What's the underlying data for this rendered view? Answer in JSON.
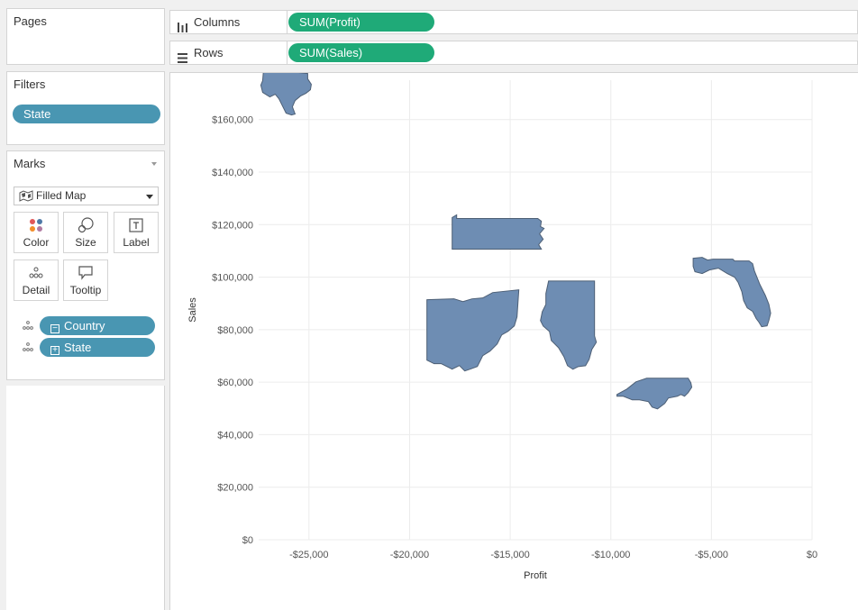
{
  "pages": {
    "title": "Pages"
  },
  "filters": {
    "title": "Filters",
    "pills": [
      {
        "label": "State"
      }
    ]
  },
  "marks": {
    "title": "Marks",
    "mark_type": "Filled Map",
    "buttons": {
      "color": "Color",
      "size": "Size",
      "label": "Label",
      "detail": "Detail",
      "tooltip": "Tooltip"
    },
    "fields": [
      {
        "label": "Country",
        "icon": "collapse-icon"
      },
      {
        "label": "State",
        "icon": "expand-icon"
      }
    ]
  },
  "shelves": {
    "columns": {
      "label": "Columns",
      "pill": "SUM(Profit)"
    },
    "rows": {
      "label": "Rows",
      "pill": "SUM(Sales)"
    }
  },
  "colors": {
    "pill_blue": "#4996b2",
    "pill_green": "#1faa78",
    "mark_fill": "#6e8db3",
    "mark_stroke": "#4d5f75"
  },
  "chart_data": {
    "type": "scatter",
    "mark": "filled-map",
    "xlabel": "Profit",
    "ylabel": "Sales",
    "xlim": [
      -27500,
      0
    ],
    "ylim": [
      0,
      175000
    ],
    "xticks": [
      -25000,
      -20000,
      -15000,
      -10000,
      -5000,
      0
    ],
    "xtick_labels": [
      "-$25,000",
      "-$20,000",
      "-$15,000",
      "-$10,000",
      "-$5,000",
      "$0"
    ],
    "yticks": [
      0,
      20000,
      40000,
      60000,
      80000,
      100000,
      120000,
      140000,
      160000
    ],
    "ytick_labels": [
      "$0",
      "$20,000",
      "$40,000",
      "$60,000",
      "$80,000",
      "$100,000",
      "$120,000",
      "$140,000",
      "$160,000"
    ],
    "grid": true,
    "points": [
      {
        "state": "Texas",
        "x": -25600,
        "y": 170000
      },
      {
        "state": "Pennsylvania",
        "x": -15600,
        "y": 116500
      },
      {
        "state": "Ohio",
        "x": -16900,
        "y": 78000
      },
      {
        "state": "Illinois",
        "x": -12600,
        "y": 80000
      },
      {
        "state": "North Carolina",
        "x": -7500,
        "y": 56000
      },
      {
        "state": "Florida",
        "x": -3400,
        "y": 89000
      }
    ]
  }
}
